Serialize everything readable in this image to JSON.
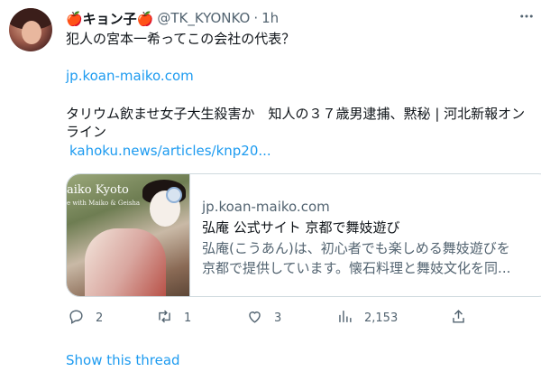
{
  "tweet": {
    "display_name": "🍎キョン子🍎",
    "handle": "@TK_KYONKO",
    "separator": "·",
    "time": "1h",
    "text_line1": "犯人の宮本一希ってこの会社の代表？",
    "link1": "jp.koan-maiko.com",
    "text_line2": "タリウム飲ませ女子大生殺害か　知人の３７歳男逮捕、黙秘 | 河北新報オン",
    "text_line3": "ライン",
    "link2": "kahoku.news/articles/knp20..."
  },
  "card": {
    "image_title": "aiko Kyoto",
    "image_sub": "e with Maiko & Geisha",
    "domain": "jp.koan-maiko.com",
    "title": "弘庵 公式サイト 京都で舞妓遊び",
    "desc_line1": "弘庵(こうあん)は、初心者でも楽しめる舞妓遊びを",
    "desc_line2": "京都で提供しています。懐石料理と舞妓文化を同..."
  },
  "actions": {
    "reply_count": "2",
    "retweet_count": "1",
    "like_count": "3",
    "views_count": "2,153"
  },
  "show_thread": "Show this thread",
  "icons": {
    "more": "more-horizontal-icon",
    "reply": "reply-icon",
    "retweet": "retweet-icon",
    "like": "heart-icon",
    "views": "views-icon",
    "share": "share-icon"
  },
  "colors": {
    "link": "#1d9bf0",
    "secondary_text": "#536471",
    "border": "#cfd9de"
  }
}
